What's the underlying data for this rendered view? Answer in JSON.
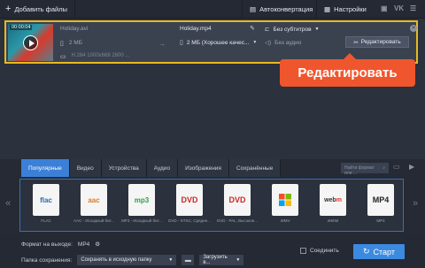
{
  "topbar": {
    "add_files": "Добавить файлы",
    "auto_convert": "Автоконвертация",
    "settings": "Настройки",
    "social": [
      "▣",
      "VK",
      "☰"
    ]
  },
  "file": {
    "thumb_time": "00:00:04",
    "source_name": "Holiday.avi",
    "source_size": "2 МБ",
    "source_meta": "H.264 1000x668 2800 ...",
    "dest_name": "Holiday.mp4",
    "dest_size": "2 МБ (Хорошее качес...",
    "subtitles": "Без субтитров",
    "audio": "Без аудио",
    "edit": "Редактировать"
  },
  "tooltip": "Редактировать",
  "tabs": [
    "Популярные",
    "Видео",
    "Устройства",
    "Аудио",
    "Изображения",
    "Сохранённые"
  ],
  "active_tab": "Популярные",
  "search_placeholder": "Найти формат или ...",
  "formats": [
    {
      "icon": "flac",
      "label": "FLAC"
    },
    {
      "icon": "aac",
      "label": "AAC - Исходный бит..."
    },
    {
      "icon": "mp3",
      "label": "MP3 - Исходный бит..."
    },
    {
      "icon": "dvd",
      "label": "DVD - NTSC, Средне..."
    },
    {
      "icon": "dvd",
      "label": "DVD - PAL, Высокое..."
    },
    {
      "icon": "wmv",
      "label": "WMV"
    },
    {
      "icon": "webm",
      "label": "WebM"
    },
    {
      "icon": "mp4",
      "label": "MP4"
    }
  ],
  "bottom": {
    "output_format_label": "Формат на выходе:",
    "output_format_value": "MP4",
    "save_folder_label": "Папка сохранения:",
    "save_folder_value": "Сохранять в исходную папку",
    "upload": "Загрузить в...",
    "merge": "Соединить",
    "start": "Старт"
  },
  "colors": {
    "accent_blue": "#3c7fd6",
    "tooltip_orange": "#f0562d",
    "selection_yellow": "#e7b91f"
  }
}
